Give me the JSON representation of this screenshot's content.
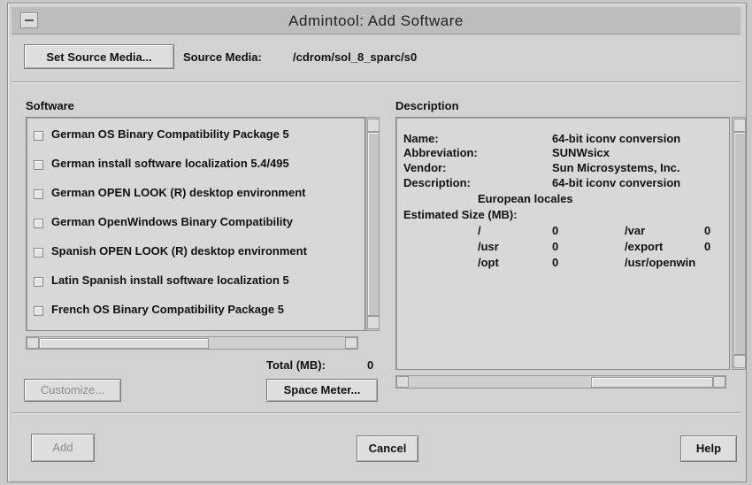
{
  "window": {
    "title": "Admintool: Add Software"
  },
  "source": {
    "set_button": "Set Source Media...",
    "label": "Source Media:",
    "path": "/cdrom/sol_8_sparc/s0"
  },
  "software": {
    "heading": "Software",
    "items": [
      "German OS Binary Compatibility Package 5",
      "German install software localization 5.4/495",
      "German OPEN LOOK (R) desktop environment",
      "German OpenWindows Binary Compatibility",
      "Spanish OPEN LOOK (R) desktop environment",
      "Latin Spanish install software localization 5",
      "French OS Binary Compatibility Package 5"
    ],
    "total_label": "Total (MB):",
    "total_value": "0",
    "customize": "Customize...",
    "space_meter": "Space Meter..."
  },
  "description": {
    "heading": "Description",
    "name_label": "Name:",
    "name_value": "64-bit iconv conversion",
    "abbr_label": "Abbreviation:",
    "abbr_value": "SUNWsicx",
    "vendor_label": "Vendor:",
    "vendor_value": "Sun Microsystems, Inc.",
    "desc_label": "Description:",
    "desc_value": "64-bit iconv conversion",
    "desc_cont": "European locales",
    "size_label": "Estimated Size (MB):",
    "sizes": [
      {
        "dir": "/",
        "val": "0",
        "dir2": "/var",
        "val2": "0"
      },
      {
        "dir": "/usr",
        "val": "0",
        "dir2": "/export",
        "val2": "0"
      },
      {
        "dir": "/opt",
        "val": "0",
        "dir2": "/usr/openwin",
        "val2": ""
      }
    ]
  },
  "footer": {
    "add": "Add",
    "cancel": "Cancel",
    "help": "Help"
  }
}
